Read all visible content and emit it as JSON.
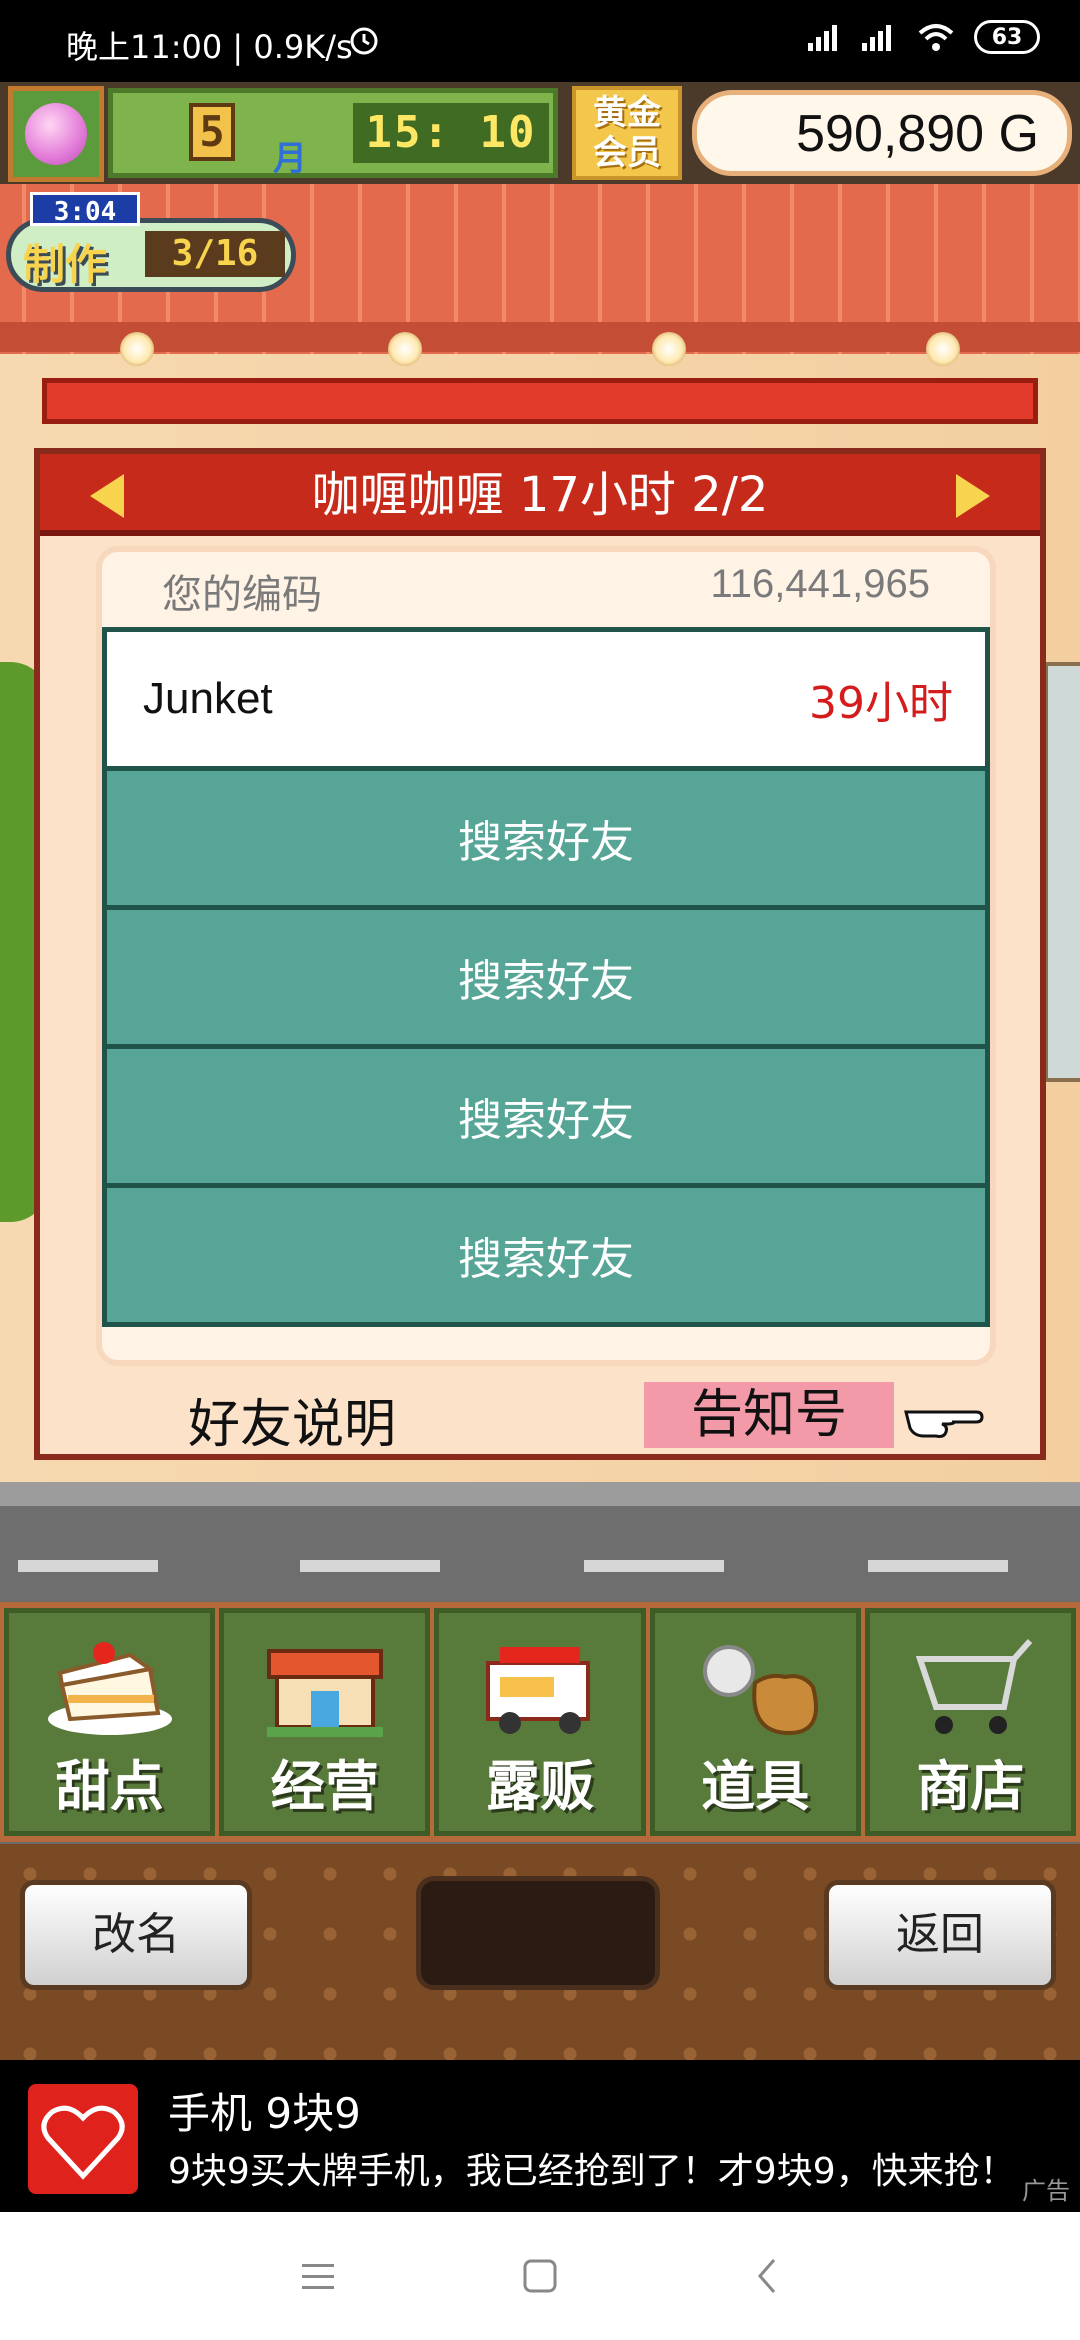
{
  "status_bar": {
    "time": "晚上11:00 | 0.9K/s",
    "battery": "63"
  },
  "hud": {
    "month_num": "5",
    "month_label": "月",
    "clock": "15: 10",
    "gold_member_line1": "黄金",
    "gold_member_line2": "会员",
    "money": "590,890 G",
    "build_time": "3:04",
    "build_label": "制作",
    "build_progress": "3/16"
  },
  "dialog": {
    "title": "咖喱咖喱  17小时 2/2",
    "code_label": "您的编码",
    "code_value": "116,441,965",
    "friends": [
      {
        "name": "Junket",
        "hours": "39小时"
      }
    ],
    "search_label": "搜索好友",
    "explain_label": "好友说明",
    "notify_label": "告知号"
  },
  "menu": [
    {
      "label": "甜点",
      "icon": "cake-icon"
    },
    {
      "label": "经营",
      "icon": "shop-icon"
    },
    {
      "label": "露贩",
      "icon": "food-truck-icon"
    },
    {
      "label": "道具",
      "icon": "items-bag-icon"
    },
    {
      "label": "商店",
      "icon": "shopping-cart-icon"
    }
  ],
  "bottom": {
    "rename": "改名",
    "back": "返回"
  },
  "ad": {
    "title": "手机 9块9",
    "desc": "9块9买大牌手机，我已经抢到了！才9块9，快来抢！",
    "tag": "广告"
  },
  "colors": {
    "dialog_header": "#c62a1b",
    "friend_empty": "#57a597",
    "hours_red": "#d41c1c"
  }
}
